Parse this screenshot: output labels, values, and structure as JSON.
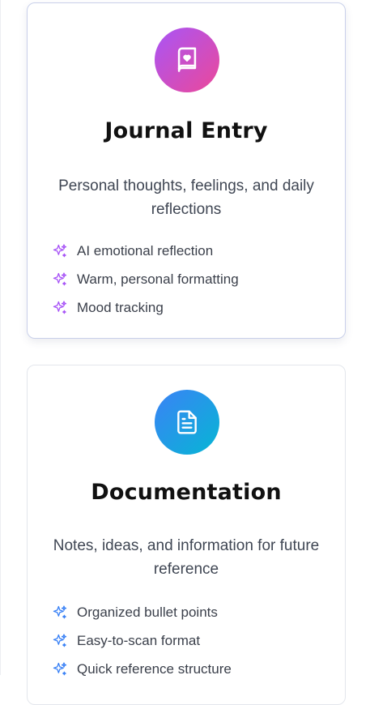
{
  "cards": [
    {
      "title": "Journal Entry",
      "description": "Personal thoughts, feelings, and daily reflections",
      "icon": "journal-heart-icon",
      "accent": "#a855f7",
      "selected": true,
      "features": [
        "AI emotional reflection",
        "Warm, personal formatting",
        "Mood tracking"
      ]
    },
    {
      "title": "Documentation",
      "description": "Notes, ideas, and information for future reference",
      "icon": "document-icon",
      "accent": "#3b82f6",
      "selected": false,
      "features": [
        "Organized bullet points",
        "Easy-to-scan format",
        "Quick reference structure"
      ]
    }
  ],
  "feature_icon": "sparkles-icon"
}
